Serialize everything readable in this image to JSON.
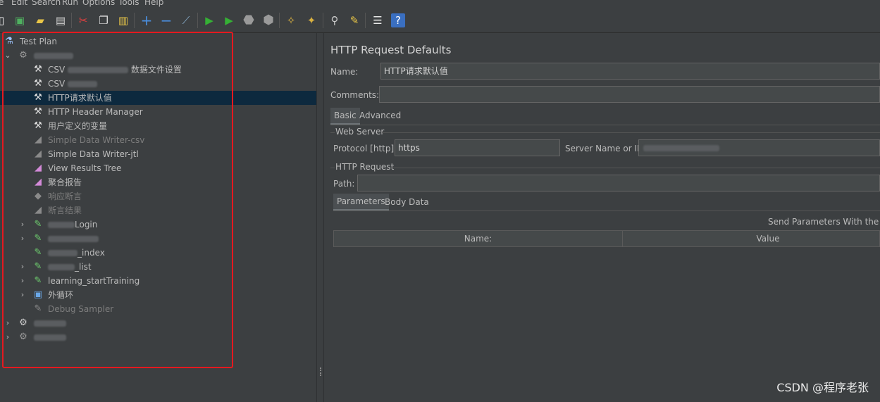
{
  "menu": [
    "e",
    "Edit",
    "Search",
    "Run",
    "Options",
    "Tools",
    "Help"
  ],
  "toolbar": {
    "icons": [
      "new-icon",
      "templates-icon",
      "open-icon",
      "save-icon",
      "cut-icon",
      "copy-icon",
      "paste-icon",
      "expand-icon",
      "collapse-icon",
      "toggle-icon",
      "start-icon",
      "start-no-pause-icon",
      "stop-icon",
      "shutdown-icon",
      "clear-icon",
      "clear-all-icon",
      "search-icon",
      "reset-search-icon",
      "function-helper-icon",
      "help-icon"
    ]
  },
  "tree": {
    "root_label": "Test Plan",
    "items": [
      {
        "label": "CSV ",
        "label_tail": "数据文件设置",
        "icon": "config-element-icon"
      },
      {
        "label": "CSV ",
        "label_tail": "",
        "icon": "config-element-icon"
      },
      {
        "label": "HTTP请求默认值",
        "icon": "config-element-icon",
        "selected": true
      },
      {
        "label": "HTTP Header Manager",
        "icon": "config-element-icon"
      },
      {
        "label": "用户定义的变量",
        "icon": "config-element-icon"
      },
      {
        "label": "Simple Data Writer-csv",
        "icon": "listener-icon",
        "disabled": true
      },
      {
        "label": "Simple Data Writer-jtl",
        "icon": "listener-icon",
        "disabled": true
      },
      {
        "label": "View Results Tree",
        "icon": "listener-icon"
      },
      {
        "label": "聚合报告",
        "icon": "listener-icon"
      },
      {
        "label": "响应断言",
        "icon": "assertion-icon",
        "disabled": true
      },
      {
        "label": "断言结果",
        "icon": "listener-icon",
        "disabled": true
      },
      {
        "label": "Login",
        "icon": "sampler-icon"
      },
      {
        "label": "",
        "icon": "sampler-icon"
      },
      {
        "label": "_index",
        "icon": "sampler-icon"
      },
      {
        "label": "_list",
        "icon": "sampler-icon"
      },
      {
        "label": "learning_startTraining",
        "icon": "sampler-icon"
      },
      {
        "label": "外循环",
        "icon": "loop-controller-icon"
      },
      {
        "label": "Debug Sampler",
        "icon": "sampler-icon",
        "disabled": true
      }
    ]
  },
  "panel": {
    "title": "HTTP Request Defaults",
    "name_label": "Name:",
    "name_value": "HTTP请求默认值",
    "comments_label": "Comments:",
    "comments_value": "",
    "tabs": [
      "Basic",
      "Advanced"
    ],
    "web_server_label": "Web Server",
    "protocol_label": "Protocol [http]:",
    "protocol_value": "https",
    "server_label": "Server Name or IP:",
    "server_value": "",
    "http_request_label": "HTTP Request",
    "path_label": "Path:",
    "path_value": "",
    "sub_tabs": [
      "Parameters",
      "Body Data"
    ],
    "send_params_label": "Send Parameters With the Requ",
    "table_columns": [
      "Name:",
      "Value"
    ]
  },
  "watermark": "CSDN @程序老张",
  "colors": {
    "background": "#3c3f41",
    "selected_row": "#0d293e",
    "highlight_box": "#e5191f",
    "field_bg": "#45494a"
  }
}
